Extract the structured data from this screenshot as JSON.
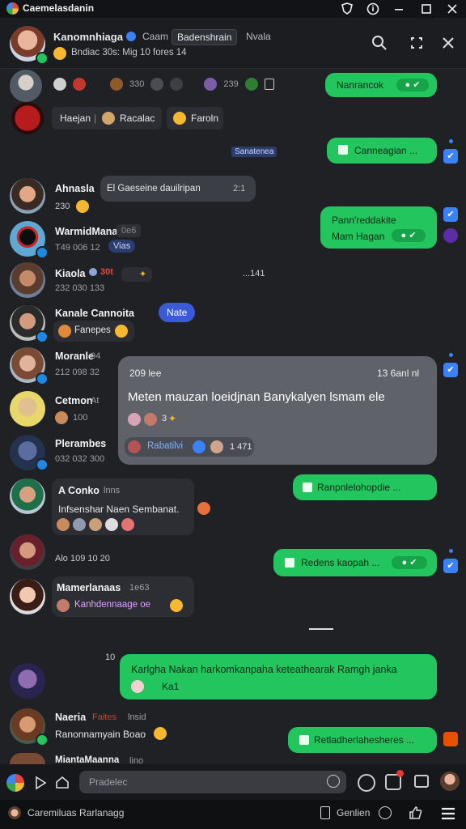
{
  "window": {
    "title": "Caemelasdanin"
  },
  "header": {
    "name": "Kanomnhiaga",
    "chip1": "Caam",
    "chip2": "Badenshrain",
    "chip3": "Nvala",
    "subtitle": "Bndiac 30s: Mig 10 fores 14"
  },
  "messages": {
    "r1_meta": "330",
    "r1_meta2": "239",
    "r1_green": "Nanrancok",
    "r2_chip1": "Haejan",
    "r2_sep": "|",
    "r2_chip2": "Racalac",
    "r2_chip3": "Faroln",
    "date_badge": "Sanatenea",
    "g_right1": "Canneagian ...",
    "u1_name": "Ahnasla",
    "u1_pill": "El Gaeseine dauilripan",
    "u1_pill_tail": "2:1",
    "u1_sub": "230",
    "g_right2_line1": "Pann'reddakite",
    "g_right2_line2": "Mam Hagan",
    "u2_name": "WarmidMana",
    "u2_tag": "0e6",
    "u2_sub": "T49 006 12",
    "u2_sub2": "Vias",
    "u3_name": "Kiaola",
    "u3_tag": "30t",
    "u3_sub": "232 030 133",
    "u3_right": "...141",
    "u4_name": "Kanale Cannoita",
    "u4_chip": "Nate",
    "u4_sub": "Fanepes",
    "u5_name": "Moranle",
    "u5_tag": "94",
    "u5_sub": "212 098 32",
    "card_top_left": "209 lee",
    "card_top_right": "13 6anl nl",
    "card_body": "Meten mauzan loeidjnan Banykalyen lsmam ele",
    "card_reactions": "3",
    "card_link": "Rabatilvi",
    "card_link_tail": "1 471",
    "u6_name": "Cetmon",
    "u6_tag": "At",
    "u6_sub": "100",
    "u7_name": "Plerambes",
    "u7_sub": "032 032 300",
    "u8_name": "A Conko",
    "u8_tag": "lnns",
    "u8_body": "Infsenshar Naen Sembanat.",
    "g_right3": "Ranpnlelohopdie ...",
    "u9_sub": "Alo 109 10 20",
    "g_right4": "Redens kaopah ...",
    "u10_name": "Mamerlanaas",
    "u10_tag": "1e63",
    "u10_sub": "Kanhdennaage oe",
    "small_time": "10",
    "g_big_line1": "Karlgha Nakan harkomkanpaha keteathearak Ramgh janka",
    "g_big_line2": "Ka1",
    "u11_name": "Naeria",
    "u11_tag1": "Faites",
    "u11_tag2": "lnsid",
    "u11_sub": "Ranonnamyain Boao",
    "g_right5": "Retladherlahesheres ...",
    "u12_name": "MiantaMaanna",
    "u12_tag": "lino"
  },
  "composer": {
    "placeholder": "Pradelec"
  },
  "bottombar": {
    "left_label": "Caremiluas Rarlanagg",
    "right_label": "Genlien"
  },
  "colors": {
    "bg": "#1f2125",
    "green": "#22c55e",
    "blue": "#3b82f6",
    "card": "#5f6269"
  }
}
